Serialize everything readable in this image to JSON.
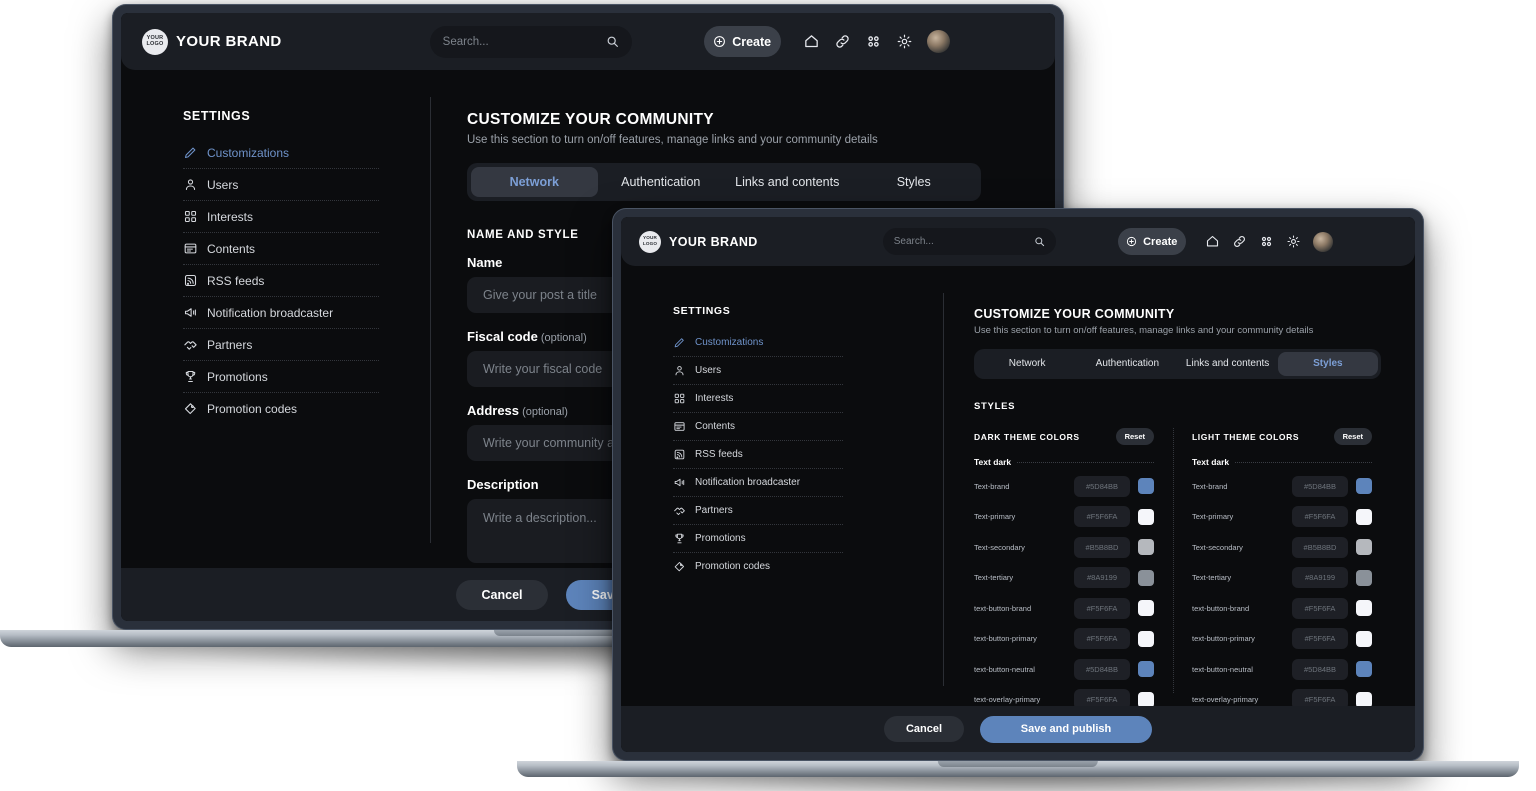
{
  "brand": {
    "logo_line1": "YOUR",
    "logo_line2": "LOGO",
    "name": "YOUR BRAND"
  },
  "header": {
    "search_placeholder": "Search...",
    "search_icon": "search-icon",
    "create_label": "Create",
    "create_icon": "plus-circle-icon",
    "icons": [
      "home-icon",
      "link-icon",
      "grid-icon",
      "gear-icon"
    ],
    "avatar": "avatar"
  },
  "sidebar": {
    "title": "SETTINGS",
    "items": [
      {
        "label": "Customizations",
        "icon": "pencil-icon",
        "active": true
      },
      {
        "label": "Users",
        "icon": "user-icon",
        "active": false
      },
      {
        "label": "Interests",
        "icon": "squares-icon",
        "active": false
      },
      {
        "label": "Contents",
        "icon": "article-icon",
        "active": false
      },
      {
        "label": "RSS feeds",
        "icon": "rss-icon",
        "active": false
      },
      {
        "label": "Notification broadcaster",
        "icon": "megaphone-icon",
        "active": false
      },
      {
        "label": "Partners",
        "icon": "handshake-icon",
        "active": false
      },
      {
        "label": "Promotions",
        "icon": "trophy-icon",
        "active": false
      },
      {
        "label": "Promotion codes",
        "icon": "tag-icon",
        "active": false
      }
    ]
  },
  "main": {
    "title": "CUSTOMIZE YOUR COMMUNITY",
    "subtitle": "Use this section to turn on/off features, manage links and your community details",
    "tabs": [
      {
        "label": "Network"
      },
      {
        "label": "Authentication"
      },
      {
        "label": "Links and contents"
      },
      {
        "label": "Styles"
      }
    ]
  },
  "back_window": {
    "active_tab": "Network",
    "section_label": "NAME AND STYLE",
    "fields": [
      {
        "label": "Name",
        "optional": "",
        "placeholder": "Give your post a title"
      },
      {
        "label": "Fiscal code",
        "optional": "(optional)",
        "placeholder": "Write your fiscal code"
      },
      {
        "label": "Address",
        "optional": "(optional)",
        "placeholder": "Write your community address"
      },
      {
        "label": "Description",
        "optional": "",
        "placeholder": "Write a description..."
      }
    ],
    "footer": {
      "cancel_label": "Cancel",
      "save_label": "Save and publish"
    }
  },
  "front_window": {
    "active_tab": "Styles",
    "section_label": "STYLES",
    "reset_label": "Reset",
    "group_label": "Text dark",
    "columns": [
      {
        "title": "DARK THEME COLORS",
        "rows": [
          {
            "name": "Text-brand",
            "hex": "#5D84BB",
            "swatch": "#5d84bb"
          },
          {
            "name": "Text-primary",
            "hex": "#F5F6FA",
            "swatch": "#f5f6fa"
          },
          {
            "name": "Text-secondary",
            "hex": "#B5B8BD",
            "swatch": "#b5b8bd"
          },
          {
            "name": "Text-tertiary",
            "hex": "#8A9199",
            "swatch": "#8a9199"
          },
          {
            "name": "text-button-brand",
            "hex": "#F5F6FA",
            "swatch": "#f5f6fa"
          },
          {
            "name": "text-button-primary",
            "hex": "#F5F6FA",
            "swatch": "#f5f6fa"
          },
          {
            "name": "text-button-neutral",
            "hex": "#5D84BB",
            "swatch": "#5d84bb"
          },
          {
            "name": "text-overlay-primary",
            "hex": "#F5F6FA",
            "swatch": "#f5f6fa"
          }
        ]
      },
      {
        "title": "LIGHT THEME COLORS",
        "rows": [
          {
            "name": "Text-brand",
            "hex": "#5D84BB",
            "swatch": "#5d84bb"
          },
          {
            "name": "Text-primary",
            "hex": "#F5F6FA",
            "swatch": "#f5f6fa"
          },
          {
            "name": "Text-secondary",
            "hex": "#B5B8BD",
            "swatch": "#b5b8bd"
          },
          {
            "name": "Text-tertiary",
            "hex": "#8A9199",
            "swatch": "#8a9199"
          },
          {
            "name": "text-button-brand",
            "hex": "#F5F6FA",
            "swatch": "#f5f6fa"
          },
          {
            "name": "text-button-primary",
            "hex": "#F5F6FA",
            "swatch": "#f5f6fa"
          },
          {
            "name": "text-button-neutral",
            "hex": "#5D84BB",
            "swatch": "#5d84bb"
          },
          {
            "name": "text-overlay-primary",
            "hex": "#F5F6FA",
            "swatch": "#f5f6fa"
          }
        ]
      }
    ],
    "footer": {
      "cancel_label": "Cancel",
      "save_label": "Save and publish"
    }
  },
  "colors": {
    "brand": "#5D84BB",
    "surface": "#1B1E24",
    "screen_bg": "#0B0C0E"
  }
}
